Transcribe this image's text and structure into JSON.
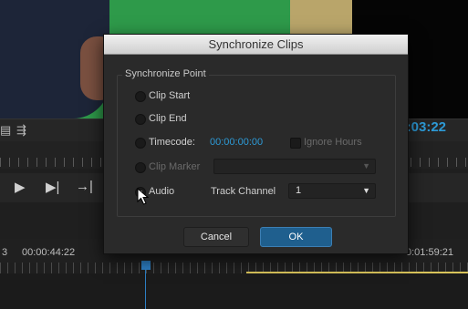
{
  "background": {
    "timecode_right": ":03:22",
    "timeline_left_partial": "3",
    "timeline_time_1": "00:00:44:22",
    "timeline_time_2": "0:01:59:21"
  },
  "dialog": {
    "title": "Synchronize Clips",
    "group_label": "Synchronize Point",
    "options": {
      "clip_start": "Clip Start",
      "clip_end": "Clip End",
      "timecode": "Timecode:",
      "timecode_value": "00:00:00:00",
      "ignore_hours": "Ignore Hours",
      "clip_marker": "Clip Marker",
      "audio": "Audio",
      "track_channel_label": "Track Channel",
      "track_channel_value": "1"
    },
    "buttons": {
      "cancel": "Cancel",
      "ok": "OK"
    }
  },
  "colors": {
    "accent_blue": "#2d9ad6",
    "ok_button": "#1f5f8e",
    "work_area_bar": "#d8c35a"
  },
  "icons": [
    "settings-icon",
    "waveform-icon",
    "play-icon",
    "step-forward-icon",
    "insert-icon",
    "dropdown-arrow-icon",
    "mouse-cursor-icon"
  ]
}
